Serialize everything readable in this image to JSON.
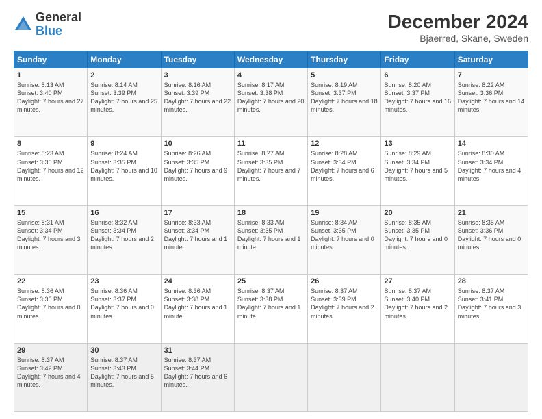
{
  "logo": {
    "general": "General",
    "blue": "Blue"
  },
  "header": {
    "title": "December 2024",
    "subtitle": "Bjaerred, Skane, Sweden"
  },
  "weekdays": [
    "Sunday",
    "Monday",
    "Tuesday",
    "Wednesday",
    "Thursday",
    "Friday",
    "Saturday"
  ],
  "weeks": [
    [
      {
        "day": "1",
        "sunrise": "8:13 AM",
        "sunset": "3:40 PM",
        "daylight": "7 hours and 27 minutes."
      },
      {
        "day": "2",
        "sunrise": "8:14 AM",
        "sunset": "3:39 PM",
        "daylight": "7 hours and 25 minutes."
      },
      {
        "day": "3",
        "sunrise": "8:16 AM",
        "sunset": "3:39 PM",
        "daylight": "7 hours and 22 minutes."
      },
      {
        "day": "4",
        "sunrise": "8:17 AM",
        "sunset": "3:38 PM",
        "daylight": "7 hours and 20 minutes."
      },
      {
        "day": "5",
        "sunrise": "8:19 AM",
        "sunset": "3:37 PM",
        "daylight": "7 hours and 18 minutes."
      },
      {
        "day": "6",
        "sunrise": "8:20 AM",
        "sunset": "3:37 PM",
        "daylight": "7 hours and 16 minutes."
      },
      {
        "day": "7",
        "sunrise": "8:22 AM",
        "sunset": "3:36 PM",
        "daylight": "7 hours and 14 minutes."
      }
    ],
    [
      {
        "day": "8",
        "sunrise": "8:23 AM",
        "sunset": "3:36 PM",
        "daylight": "7 hours and 12 minutes."
      },
      {
        "day": "9",
        "sunrise": "8:24 AM",
        "sunset": "3:35 PM",
        "daylight": "7 hours and 10 minutes."
      },
      {
        "day": "10",
        "sunrise": "8:26 AM",
        "sunset": "3:35 PM",
        "daylight": "7 hours and 9 minutes."
      },
      {
        "day": "11",
        "sunrise": "8:27 AM",
        "sunset": "3:35 PM",
        "daylight": "7 hours and 7 minutes."
      },
      {
        "day": "12",
        "sunrise": "8:28 AM",
        "sunset": "3:34 PM",
        "daylight": "7 hours and 6 minutes."
      },
      {
        "day": "13",
        "sunrise": "8:29 AM",
        "sunset": "3:34 PM",
        "daylight": "7 hours and 5 minutes."
      },
      {
        "day": "14",
        "sunrise": "8:30 AM",
        "sunset": "3:34 PM",
        "daylight": "7 hours and 4 minutes."
      }
    ],
    [
      {
        "day": "15",
        "sunrise": "8:31 AM",
        "sunset": "3:34 PM",
        "daylight": "7 hours and 3 minutes."
      },
      {
        "day": "16",
        "sunrise": "8:32 AM",
        "sunset": "3:34 PM",
        "daylight": "7 hours and 2 minutes."
      },
      {
        "day": "17",
        "sunrise": "8:33 AM",
        "sunset": "3:34 PM",
        "daylight": "7 hours and 1 minute."
      },
      {
        "day": "18",
        "sunrise": "8:33 AM",
        "sunset": "3:35 PM",
        "daylight": "7 hours and 1 minute."
      },
      {
        "day": "19",
        "sunrise": "8:34 AM",
        "sunset": "3:35 PM",
        "daylight": "7 hours and 0 minutes."
      },
      {
        "day": "20",
        "sunrise": "8:35 AM",
        "sunset": "3:35 PM",
        "daylight": "7 hours and 0 minutes."
      },
      {
        "day": "21",
        "sunrise": "8:35 AM",
        "sunset": "3:36 PM",
        "daylight": "7 hours and 0 minutes."
      }
    ],
    [
      {
        "day": "22",
        "sunrise": "8:36 AM",
        "sunset": "3:36 PM",
        "daylight": "7 hours and 0 minutes."
      },
      {
        "day": "23",
        "sunrise": "8:36 AM",
        "sunset": "3:37 PM",
        "daylight": "7 hours and 0 minutes."
      },
      {
        "day": "24",
        "sunrise": "8:36 AM",
        "sunset": "3:38 PM",
        "daylight": "7 hours and 1 minute."
      },
      {
        "day": "25",
        "sunrise": "8:37 AM",
        "sunset": "3:38 PM",
        "daylight": "7 hours and 1 minute."
      },
      {
        "day": "26",
        "sunrise": "8:37 AM",
        "sunset": "3:39 PM",
        "daylight": "7 hours and 2 minutes."
      },
      {
        "day": "27",
        "sunrise": "8:37 AM",
        "sunset": "3:40 PM",
        "daylight": "7 hours and 2 minutes."
      },
      {
        "day": "28",
        "sunrise": "8:37 AM",
        "sunset": "3:41 PM",
        "daylight": "7 hours and 3 minutes."
      }
    ],
    [
      {
        "day": "29",
        "sunrise": "8:37 AM",
        "sunset": "3:42 PM",
        "daylight": "7 hours and 4 minutes."
      },
      {
        "day": "30",
        "sunrise": "8:37 AM",
        "sunset": "3:43 PM",
        "daylight": "7 hours and 5 minutes."
      },
      {
        "day": "31",
        "sunrise": "8:37 AM",
        "sunset": "3:44 PM",
        "daylight": "7 hours and 6 minutes."
      },
      null,
      null,
      null,
      null
    ]
  ],
  "labels": {
    "sunrise": "Sunrise:",
    "sunset": "Sunset:",
    "daylight": "Daylight:"
  }
}
